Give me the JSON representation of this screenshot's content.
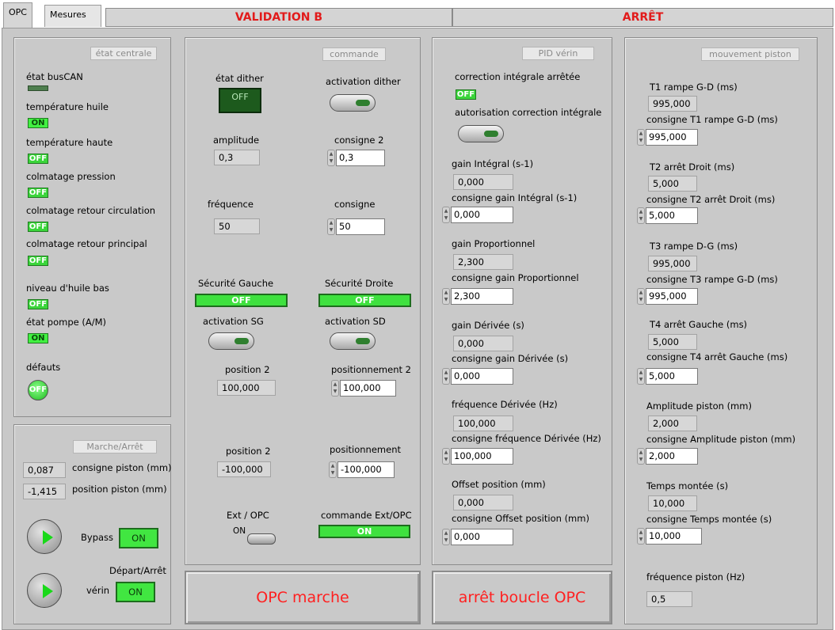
{
  "tabs": [
    {
      "label": "OPC",
      "active": true
    },
    {
      "label": "Mesures",
      "active": false
    }
  ],
  "top_buttons": {
    "validation": "VALIDATION B",
    "stop": "ARRÊT"
  },
  "etat_centrale": {
    "title": "état centrale",
    "items": [
      {
        "label": "état busCAN",
        "led": ""
      },
      {
        "label": "température huile",
        "led": "ON"
      },
      {
        "label": "température haute",
        "led": "OFF"
      },
      {
        "label": "colmatage pression",
        "led": "OFF"
      },
      {
        "label": "colmatage retour circulation",
        "led": "OFF"
      },
      {
        "label": "colmatage retour principal",
        "led": "OFF"
      },
      {
        "label": "niveau d'huile bas",
        "led": "OFF"
      },
      {
        "label": "état pompe (A/M)",
        "led": "ON"
      },
      {
        "label": "défauts",
        "led": "OFF"
      }
    ]
  },
  "marche_arret": {
    "title": "Marche/Arrêt",
    "consigne_piston_value": "0,087",
    "consigne_piston_label": "consigne piston (mm)",
    "position_piston_value": "-1,415",
    "position_piston_label": "position piston (mm)",
    "bypass_label": "Bypass",
    "bypass_state": "ON",
    "depart_label": "Départ/Arrêt",
    "verin_label": "vérin",
    "verin_state": "ON"
  },
  "commande": {
    "title": "commande",
    "etat_dither_label": "état dither",
    "etat_dither_state": "OFF",
    "activation_dither_label": "activation dither",
    "amplitude_label": "amplitude",
    "amplitude_value": "0,3",
    "consigne2_label": "consigne 2",
    "consigne2_value": "0,3",
    "frequence_label": "fréquence",
    "frequence_value": "50",
    "consigne_label": "consigne",
    "consigne_value": "50",
    "securite_gauche_label": "Sécurité Gauche",
    "securite_gauche_state": "OFF",
    "securite_droite_label": "Sécurité Droite",
    "securite_droite_state": "OFF",
    "activation_sg_label": "activation SG",
    "activation_sd_label": "activation SD",
    "position2a_label": "position  2",
    "position2a_value": "100,000",
    "positionnement2_label": "positionnement 2",
    "positionnement2_value": "100,000",
    "position2b_label": "position 2",
    "position2b_value": "-100,000",
    "positionnement_label": "positionnement",
    "positionnement_value": "-100,000",
    "ext_opc_label": "Ext / OPC",
    "ext_opc_state": "ON",
    "commande_ext_label": "commande Ext/OPC",
    "commande_ext_state": "ON"
  },
  "pid": {
    "title": "PID vérin",
    "correction_label": "correction intégrale arrêtée",
    "correction_state": "OFF",
    "autorisation_label": "autorisation correction intégrale",
    "fields": [
      {
        "label": "gain Intégral (s-1)",
        "value": "0,000",
        "consigne_label": "consigne gain Intégral (s-1)",
        "consigne_value": "0,000"
      },
      {
        "label": "gain Proportionnel",
        "value": "2,300",
        "consigne_label": "consigne gain Proportionnel",
        "consigne_value": "2,300"
      },
      {
        "label": "gain Dérivée (s)",
        "value": "0,000",
        "consigne_label": "consigne gain Dérivée (s)",
        "consigne_value": "0,000"
      },
      {
        "label": "fréquence Dérivée (Hz)",
        "value": "100,000",
        "consigne_label": "consigne fréquence Dérivée (Hz)",
        "consigne_value": "100,000"
      },
      {
        "label": "Offset position (mm)",
        "value": "0,000",
        "consigne_label": "consigne Offset position (mm)",
        "consigne_value": "0,000"
      }
    ]
  },
  "mouvement": {
    "title": "mouvement piston",
    "fields": [
      {
        "label": "T1 rampe G-D (ms)",
        "value": "995,000",
        "consigne_label": "consigne T1 rampe G-D (ms)",
        "consigne_value": "995,000"
      },
      {
        "label": "T2 arrêt Droit (ms)",
        "value": "5,000",
        "consigne_label": "consigne T2 arrêt Droit (ms)",
        "consigne_value": "5,000"
      },
      {
        "label": "T3 rampe D-G (ms)",
        "value": "995,000",
        "consigne_label": "consigne T3 rampe G-D (ms)",
        "consigne_value": "995,000"
      },
      {
        "label": "T4 arrêt Gauche (ms)",
        "value": "5,000",
        "consigne_label": "consigne T4 arrêt Gauche (ms)",
        "consigne_value": "5,000"
      },
      {
        "label": "Amplitude piston (mm)",
        "value": "2,000",
        "consigne_label": "consigne Amplitude piston (mm)",
        "consigne_value": "2,000"
      },
      {
        "label": "Temps montée (s)",
        "value": "10,000",
        "consigne_label": "consigne Temps montée (s)",
        "consigne_value": "10,000"
      }
    ],
    "frequence_label": "fréquence piston (Hz)",
    "frequence_value": "0,5"
  },
  "bottom_buttons": {
    "opc_marche": "OPC marche",
    "arret_boucle": "arrêt boucle OPC"
  }
}
